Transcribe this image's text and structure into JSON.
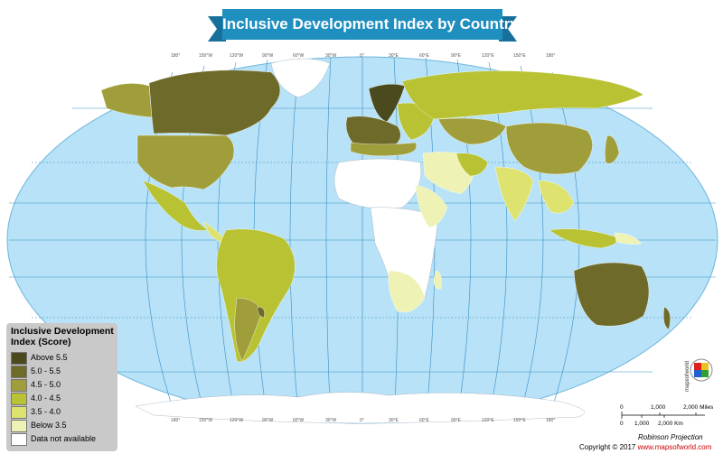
{
  "title": "Inclusive Development Index by Country",
  "longitudes_top": [
    "180°",
    "150°W",
    "120°W",
    "90°W",
    "60°W",
    "30°W",
    "0°",
    "30°E",
    "60°E",
    "90°E",
    "120°E",
    "150°E",
    "180°"
  ],
  "longitudes_bottom": [
    "180°",
    "150°W",
    "120°W",
    "90°W",
    "60°W",
    "30°W",
    "0°",
    "30°E",
    "60°E",
    "90°E",
    "120°E",
    "150°E",
    "180°"
  ],
  "legend": {
    "title": "Inclusive Development Index (Score)",
    "items": [
      {
        "label": "Above 5.5",
        "color": "#4a4a1e"
      },
      {
        "label": "5.0 - 5.5",
        "color": "#6e6a2a"
      },
      {
        "label": "4.5 - 5.0",
        "color": "#a09e3a"
      },
      {
        "label": "4.0 - 4.5",
        "color": "#b8c232"
      },
      {
        "label": "3.5 - 4.0",
        "color": "#dde36e"
      },
      {
        "label": "Below 3.5",
        "color": "#eef2b4"
      },
      {
        "label": "Data not available",
        "color": "#ffffff"
      }
    ]
  },
  "scale": {
    "miles_0": "0",
    "miles_1": "1,000",
    "miles_2": "2,000 Miles",
    "km_0": "0",
    "km_1": "1,000",
    "km_2": "2,000 Km"
  },
  "projection": "Robinson Projection",
  "copyright": {
    "prefix": "Copyright © 2017 ",
    "brand": "www.mapsofworld.com"
  },
  "logo_text": "mapsofworld",
  "colors": {
    "ocean": "#b7e2f7",
    "graticule": "#3a8fc4",
    "banner": "#1f8fbf"
  }
}
